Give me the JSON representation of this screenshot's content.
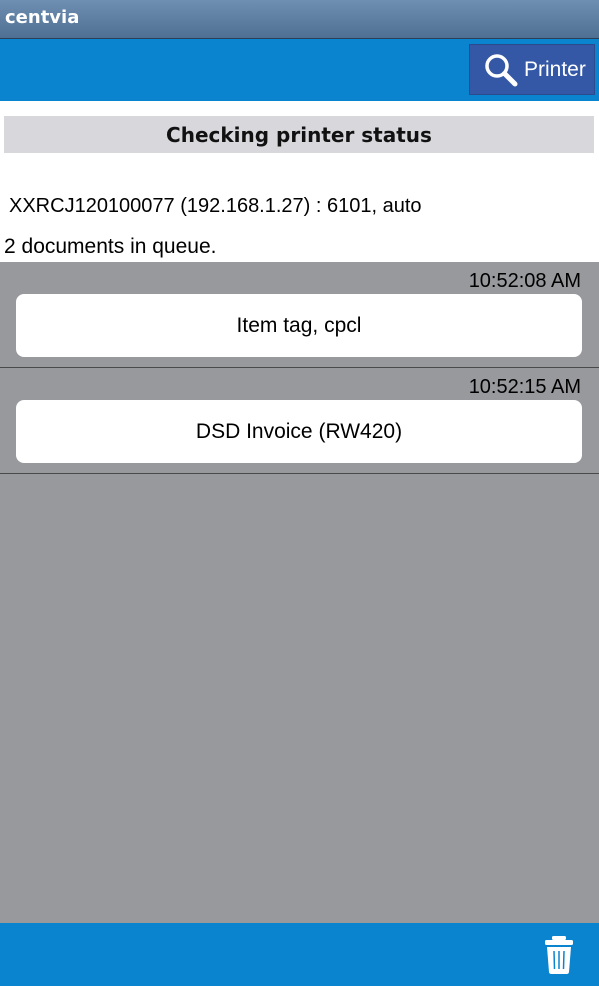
{
  "app": {
    "title": "centvia"
  },
  "toolbar": {
    "printer_label": "Printer",
    "printer_icon": "search-icon"
  },
  "status": {
    "title": "Checking printer status"
  },
  "printer": {
    "info": "XXRCJ120100077 (192.168.1.27) : 6101, auto"
  },
  "queue": {
    "count_text": "2 documents in queue.",
    "items": [
      {
        "time": "10:52:08 AM",
        "name": "Item tag, cpcl"
      },
      {
        "time": "10:52:15 AM",
        "name": "DSD Invoice (RW420)"
      }
    ]
  },
  "footer": {
    "delete_icon": "trash-icon"
  },
  "colors": {
    "action_bar": "#0a84cf",
    "printer_button": "#3558a6",
    "queue_background": "#98999d",
    "status_header": "#d8d7dc"
  }
}
